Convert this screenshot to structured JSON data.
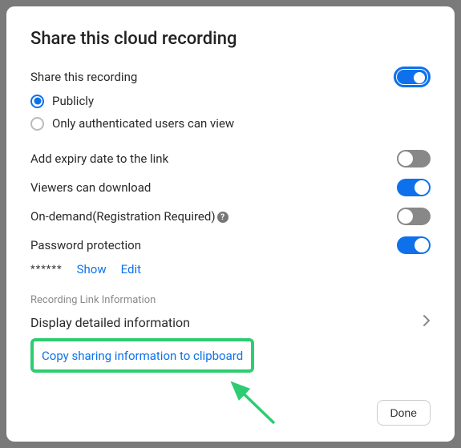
{
  "title": "Share this cloud recording",
  "share": {
    "label": "Share this recording",
    "toggle_on": true,
    "options": [
      {
        "label": "Publicly",
        "selected": true
      },
      {
        "label": "Only authenticated users can view",
        "selected": false
      }
    ]
  },
  "settings": {
    "expiry": {
      "label": "Add expiry date to the link",
      "on": false
    },
    "download": {
      "label": "Viewers can download",
      "on": true
    },
    "ondemand": {
      "label": "On-demand(Registration Required)",
      "on": false
    },
    "password": {
      "label": "Password protection",
      "on": true
    }
  },
  "password": {
    "masked": "******",
    "show_label": "Show",
    "edit_label": "Edit"
  },
  "link_section": {
    "heading": "Recording Link Information",
    "detail_label": "Display detailed information",
    "copy_label": "Copy sharing information to clipboard"
  },
  "footer": {
    "done_label": "Done"
  },
  "colors": {
    "accent": "#0E71EB",
    "highlight": "#2ECC71"
  }
}
